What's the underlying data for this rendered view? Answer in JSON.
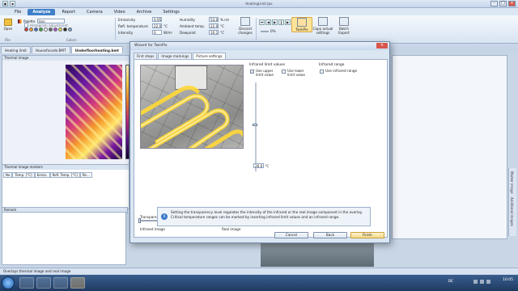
{
  "window": {
    "title": "HeatingLimit.tpx"
  },
  "menu": {
    "tabs": [
      "File",
      "Analyze",
      "Report",
      "Camera",
      "Video",
      "Archive",
      "Settings"
    ],
    "active": "Analyze"
  },
  "ribbon": {
    "open_label": "Open",
    "palette_label": "Palette",
    "palette_value": "Iron",
    "histogram_label": "Histogram adjustment",
    "file_group": "File",
    "colors_group": "Colors",
    "emissivity_label": "Emissivity",
    "emissivity_value": "0.95",
    "refl_temp_label": "Refl. temperature",
    "refl_temp_value": "22.0",
    "intensity_label": "Intensity",
    "intensity_value": "0",
    "humidity_label": "Humidity",
    "humidity_value": "53.0",
    "humidity_unit": "% rel",
    "ambient_label": "Ambient temp.",
    "ambient_value": "22.0",
    "dewpoint_label": "Dewpoint",
    "dewpoint_value": "10.1",
    "unit_c": "°C",
    "unit_wm2": "W/m²",
    "discard_label": "Discard changes",
    "twinpix_label": "TwinPix",
    "copy_label": "Copy actual settings",
    "batch_label": "Batch Export",
    "zoom_value": "0%"
  },
  "doc_tabs": [
    "Heating limit",
    "Housefacade.BMT",
    "Underfloorheating.bmt"
  ],
  "doc_active": "Underfloorheating.bmt",
  "left": {
    "thermal_head": "Thermal image",
    "markers_head": "Thermal image markers",
    "grid_cols": [
      "No",
      "Temp. [°C]",
      "Emiss.",
      "Refl. Temp. [°C]",
      "Re..."
    ],
    "remark_head": "Remark"
  },
  "side_tabs": [
    "Marker image",
    "Additional images"
  ],
  "dialog": {
    "title": "Wizard for TwinPix",
    "tabs": [
      "First steps",
      "Image markings",
      "Picture settings"
    ],
    "active_tab": "Picture settings",
    "ir_limit_group": "Infrared limit values",
    "use_upper": "Use upper limit value",
    "use_lower": "Use lower limit value",
    "ir_range_group": "Infrared range",
    "use_ir_range": "Use infrared range",
    "temp_value": "26.0",
    "temp_unit": "°C",
    "transparency_label": "Transparency level",
    "ir_image": "Infrared image",
    "real_image": "Real image",
    "info_text": "Setting the transparency level regulates the intensity of the infrared or the real image component in the overlay. Critical temperature ranges can be marked by inserting infrared limit values and an infrared range.",
    "cancel": "Cancel",
    "back": "Back",
    "finish": "Finish"
  },
  "status": {
    "text": "Overlays thermal image and real image"
  },
  "taskbar": {
    "lang": "DE",
    "time": "10:05"
  }
}
